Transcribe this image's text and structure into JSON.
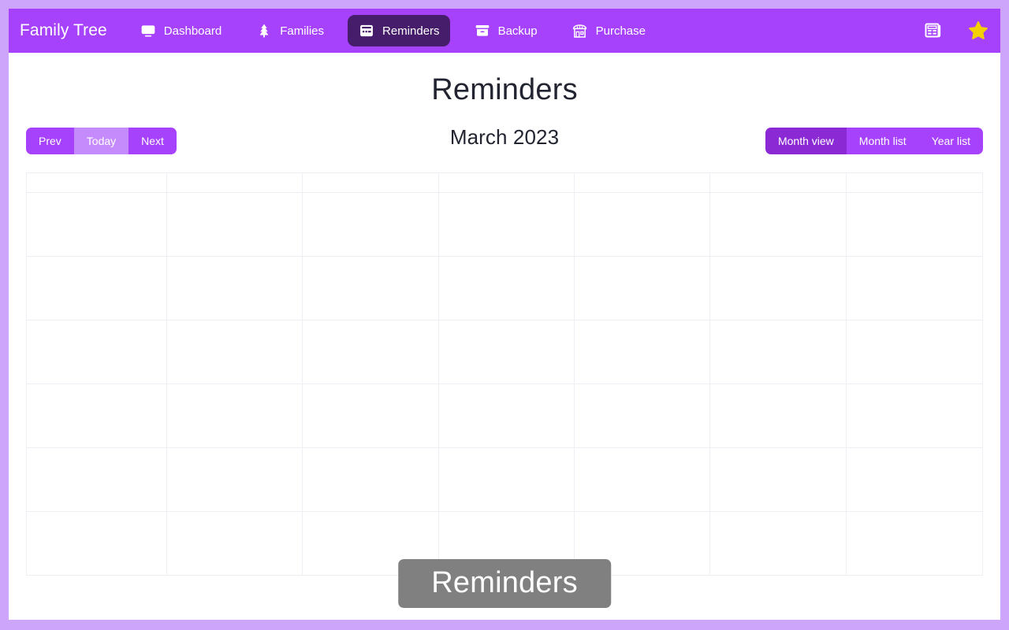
{
  "navbar": {
    "brand": "Family Tree",
    "items": [
      {
        "label": "Dashboard",
        "icon": "monitor-icon",
        "active": false
      },
      {
        "label": "Families",
        "icon": "tree-icon",
        "active": false
      },
      {
        "label": "Reminders",
        "icon": "calendar-icon",
        "active": true
      },
      {
        "label": "Backup",
        "icon": "archive-icon",
        "active": false
      },
      {
        "label": "Purchase",
        "icon": "store-icon",
        "active": false
      }
    ],
    "right_icons": [
      {
        "name": "newspaper-icon",
        "label": "News"
      },
      {
        "name": "star-icon",
        "label": "Favorites"
      }
    ],
    "background_color": "#a742fc",
    "active_tab_color": "#451d6b",
    "star_color": "#f5d000"
  },
  "page": {
    "title": "Reminders",
    "month_label": "March 2023"
  },
  "nav_buttons": [
    {
      "label": "Prev",
      "state": "normal"
    },
    {
      "label": "Today",
      "state": "muted"
    },
    {
      "label": "Next",
      "state": "normal"
    }
  ],
  "view_buttons": [
    {
      "label": "Month view",
      "state": "selected"
    },
    {
      "label": "Month list",
      "state": "normal"
    },
    {
      "label": "Year list",
      "state": "normal"
    }
  ],
  "calendar": {
    "weekday_headers": [
      "",
      "",
      "",
      "",
      "",
      "",
      ""
    ],
    "rows": [
      [
        "",
        "",
        "",
        "",
        "",
        "",
        ""
      ],
      [
        "",
        "",
        "",
        "",
        "",
        "",
        ""
      ],
      [
        "",
        "",
        "",
        "",
        "",
        "",
        ""
      ],
      [
        "",
        "",
        "",
        "",
        "",
        "",
        ""
      ],
      [
        "",
        "",
        "",
        "",
        "",
        "",
        ""
      ],
      [
        "",
        "",
        "",
        "",
        "",
        "",
        ""
      ]
    ],
    "grid_line_color": "#eceff4"
  },
  "toast": {
    "message": "Reminders",
    "background_color": "#808080"
  },
  "frame": {
    "border_color": "#cda6fb"
  }
}
